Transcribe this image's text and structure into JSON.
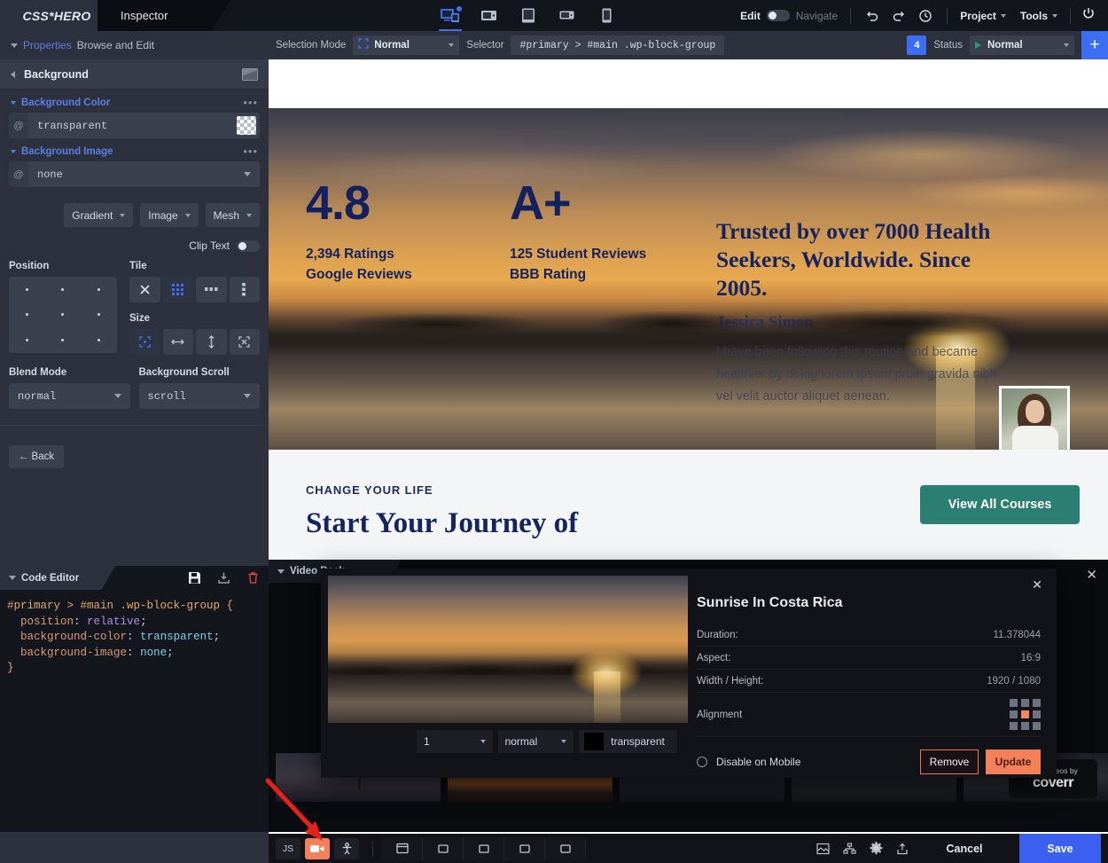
{
  "app": {
    "logo": "CSS*HERO",
    "tab": "Inspector"
  },
  "topbar": {
    "devices": [
      {
        "name": "desktop-icon",
        "label": "Desktop",
        "active": true
      },
      {
        "name": "laptop-icon",
        "label": "Laptop",
        "active": false
      },
      {
        "name": "tablet-icon",
        "label": "Tablet",
        "active": false
      },
      {
        "name": "tablet-landscape-icon",
        "label": "Tablet Landscape",
        "active": false
      },
      {
        "name": "mobile-icon",
        "label": "Mobile",
        "active": false
      }
    ],
    "edit_label": "Edit",
    "navigate_label": "Navigate",
    "undo_label": "Undo",
    "redo_label": "Redo",
    "history_label": "History",
    "project_label": "Project",
    "tools_label": "Tools",
    "power_label": "Exit"
  },
  "selectorbar": {
    "selection_mode_label": "Selection Mode",
    "selection_mode_value": "Normal",
    "selector_label": "Selector",
    "selector_value": "#primary > #main .wp-block-group",
    "count_badge": "4",
    "status_label": "Status",
    "status_value": "Normal",
    "add_label": "+"
  },
  "inspector": {
    "properties_label": "Properties",
    "browse_label": "Browse and Edit",
    "section_title": "Background",
    "background_color": {
      "label": "Background Color",
      "value": "transparent",
      "at": "@"
    },
    "background_image": {
      "label": "Background Image",
      "value": "none",
      "at": "@"
    },
    "buttons": [
      {
        "label": "Gradient"
      },
      {
        "label": "Image"
      },
      {
        "label": "Mesh"
      }
    ],
    "clip_text_label": "Clip Text",
    "position_label": "Position",
    "tile_label": "Tile",
    "tile_options": [
      "no-repeat",
      "repeat",
      "repeat-x",
      "repeat-y"
    ],
    "tile_selected": 1,
    "size_label": "Size",
    "size_options": [
      "auto",
      "width",
      "height",
      "contain"
    ],
    "size_selected": 0,
    "blend_mode_label": "Blend Mode",
    "blend_mode_value": "normal",
    "background_scroll_label": "Background Scroll",
    "background_scroll_value": "scroll",
    "back_label": "← Back"
  },
  "code_editor": {
    "tab_label": "Code Editor",
    "save_icon": "save-icon",
    "export_icon": "export-icon",
    "delete_icon": "trash-icon",
    "selector": "#primary > #main .wp-block-group {",
    "declarations": [
      {
        "prop": "position",
        "value": "relative"
      },
      {
        "prop": "background-color",
        "value": "transparent"
      },
      {
        "prop": "background-image",
        "value": "none"
      }
    ],
    "close_brace": "}"
  },
  "preview": {
    "stats": [
      {
        "big": "4.8",
        "line1": "2,394 Ratings",
        "line2": "Google Reviews"
      },
      {
        "big": "A+",
        "line1": "125 Student Reviews",
        "line2": "BBB Rating"
      }
    ],
    "headline": "Trusted by over 7000 Health Seekers, Worldwide. Since 2005.",
    "author": "Jessica Simon",
    "body": "I have been following this routine and became healthier by doing lorem ipsum proin gravida nibh vel velit auctor aliquet aenean.",
    "kicker": "CHANGE YOUR LIFE",
    "section_title": "Start Your Journey of",
    "cta_label": "View All Courses"
  },
  "video_panel": {
    "tab_label": "Video Back",
    "close": "✕",
    "coverr_top": "Free videos by",
    "coverr_name": "coverr"
  },
  "modal": {
    "title": "Sunrise In Costa Rica",
    "close": "✕",
    "rows": [
      {
        "label": "Duration:",
        "value": "11.378044"
      },
      {
        "label": "Aspect:",
        "value": "16:9"
      },
      {
        "label": "Width / Height:",
        "value": "1920 / 1080"
      }
    ],
    "alignment_label": "Alignment",
    "alignment_selected": 4,
    "disable_mobile_label": "Disable on Mobile",
    "remove_label": "Remove",
    "update_label": "Update",
    "controls": {
      "speed": "1",
      "blend": "normal",
      "color": "transparent"
    }
  },
  "bottombar": {
    "js_label": "JS",
    "video_icon": "video-camera-icon",
    "person_icon": "person-icon",
    "breadcrumbs": [
      "body-icon",
      "section-icon",
      "div-icon",
      "group-icon",
      "block-icon"
    ],
    "right_icons": [
      "image-icon",
      "sitemap-icon",
      "gear-icon",
      "upload-icon"
    ],
    "cancel_label": "Cancel",
    "save_label": "Save"
  },
  "colors": {
    "accent_blue": "#3b6ef0",
    "accent_orange": "#f4805a",
    "panel_bg": "#2c313d",
    "dark_bg": "#12151c",
    "green": "#2a7f72",
    "navy": "#15235f"
  }
}
